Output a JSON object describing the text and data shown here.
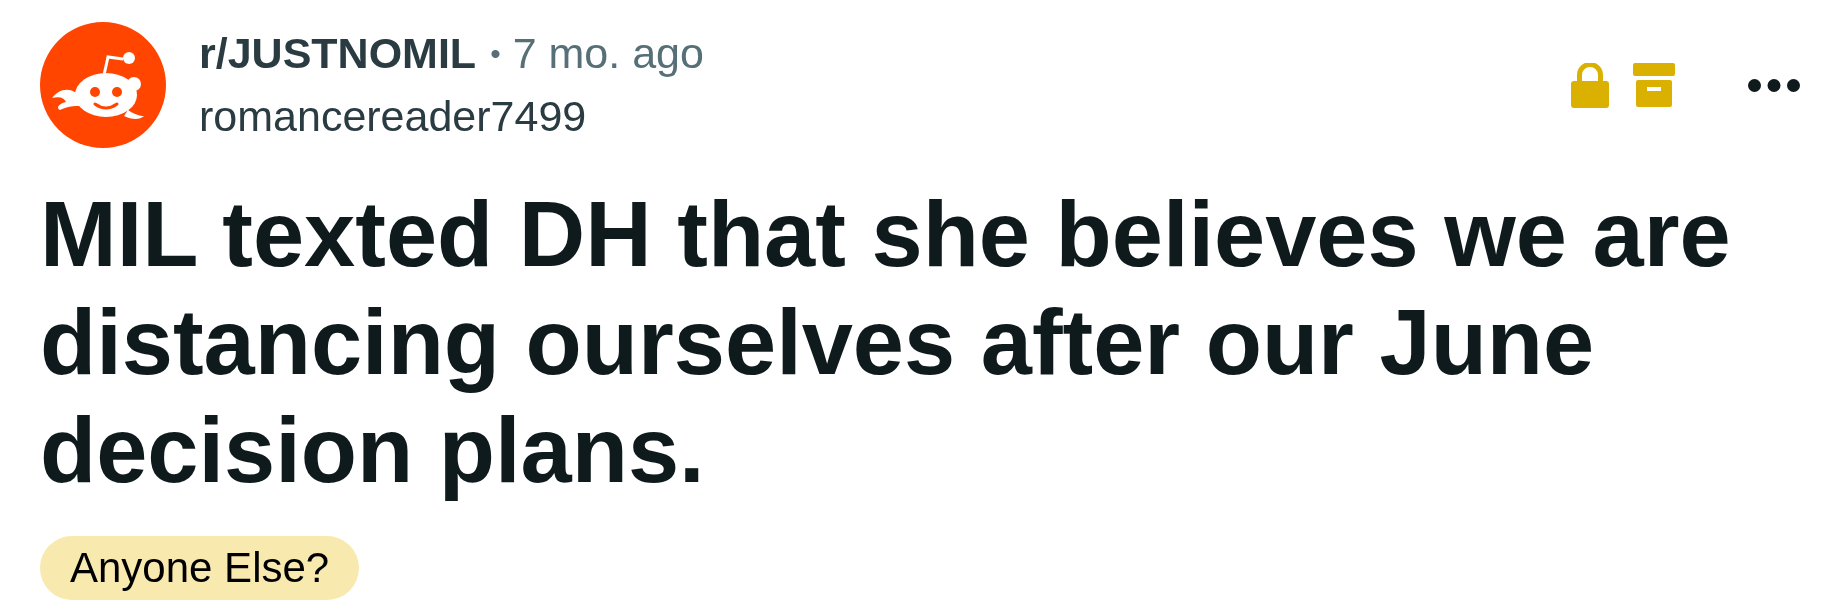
{
  "post": {
    "subreddit": "r/JUSTNOMIL",
    "separator": "•",
    "age": "7 mo. ago",
    "author": "romancereader7499",
    "locked": true,
    "archived": true,
    "title": "MIL texted DH that she believes we are distancing ourselves after our June decision plans.",
    "flair": "Anyone Else?"
  }
}
